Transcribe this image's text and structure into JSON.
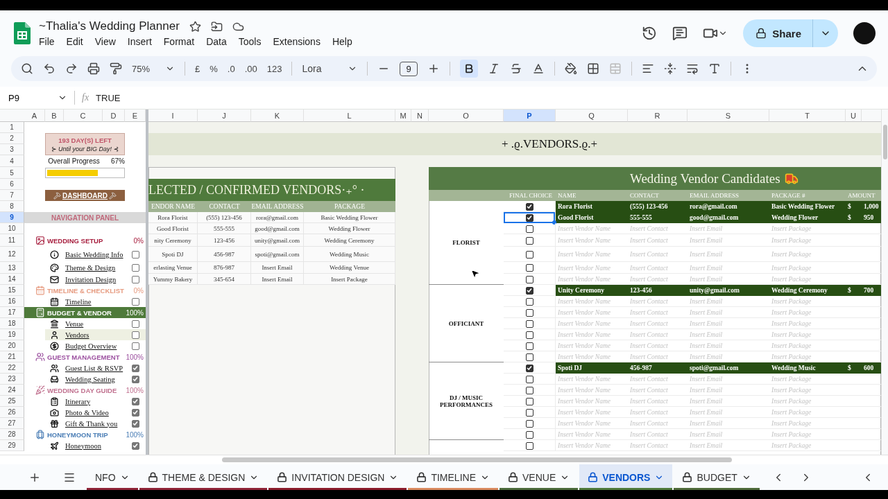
{
  "document": {
    "title": "~Thalia's Wedding Planner"
  },
  "menu": [
    "File",
    "Edit",
    "View",
    "Insert",
    "Format",
    "Data",
    "Tools",
    "Extensions",
    "Help"
  ],
  "share_button": {
    "label": "Share"
  },
  "toolbar": {
    "zoom": "75%",
    "currency": "£",
    "percent": "%",
    "decimals_less": ".0",
    "decimals_more": ".00",
    "number_format": "123",
    "font": "Lora",
    "font_size": "9",
    "bold_selected": true
  },
  "formula_bar": {
    "cell": "P9",
    "function_label": "fx",
    "value": "TRUE"
  },
  "columns": [
    {
      "label": "A",
      "selected": false
    },
    {
      "label": "B",
      "selected": false
    },
    {
      "label": "C",
      "selected": false
    },
    {
      "label": "D",
      "selected": false
    },
    {
      "label": "E",
      "selected": false
    },
    {
      "label": "I",
      "selected": false
    },
    {
      "label": "J",
      "selected": false
    },
    {
      "label": "K",
      "selected": false
    },
    {
      "label": "L",
      "selected": false
    },
    {
      "label": "M",
      "selected": false
    },
    {
      "label": "N",
      "selected": false
    },
    {
      "label": "O",
      "selected": false
    },
    {
      "label": "P",
      "selected": true
    },
    {
      "label": "Q",
      "selected": false
    },
    {
      "label": "R",
      "selected": false
    },
    {
      "label": "S",
      "selected": false
    },
    {
      "label": "T",
      "selected": false
    },
    {
      "label": "U",
      "selected": false
    }
  ],
  "rows": [
    {
      "label": "1",
      "selected": false
    },
    {
      "label": "2",
      "selected": false
    },
    {
      "label": "3",
      "selected": false
    },
    {
      "label": "4",
      "selected": false
    },
    {
      "label": "5",
      "selected": false
    },
    {
      "label": "6",
      "selected": false
    },
    {
      "label": "7",
      "selected": false
    },
    {
      "label": "8",
      "selected": false
    },
    {
      "label": "9",
      "selected": true
    },
    {
      "label": "10",
      "selected": false
    },
    {
      "label": "11",
      "selected": false
    },
    {
      "label": "12",
      "selected": false
    },
    {
      "label": "13",
      "selected": false
    },
    {
      "label": "14",
      "selected": false
    },
    {
      "label": "15",
      "selected": false
    },
    {
      "label": "16",
      "selected": false
    },
    {
      "label": "17",
      "selected": false
    },
    {
      "label": "18",
      "selected": false
    },
    {
      "label": "19",
      "selected": false
    },
    {
      "label": "20",
      "selected": false
    },
    {
      "label": "21",
      "selected": false
    },
    {
      "label": "22",
      "selected": false
    },
    {
      "label": "23",
      "selected": false
    },
    {
      "label": "24",
      "selected": false
    },
    {
      "label": "25",
      "selected": false
    },
    {
      "label": "26",
      "selected": false
    },
    {
      "label": "27",
      "selected": false
    },
    {
      "label": "28",
      "selected": false
    },
    {
      "label": "29",
      "selected": false
    }
  ],
  "countdown": {
    "days_left": "193 DAY(S) LEFT",
    "caption": "⊱ Until your BIG Day! ⊰"
  },
  "overall_progress": {
    "label": "Overall Progress",
    "reading": "67%",
    "level": 0.67
  },
  "dashboard_button": {
    "label": "DASHBOARD"
  },
  "navigation": {
    "title": "NAVIGATION PANEL",
    "sections": [
      {
        "title": "WEDDING SETUP",
        "percent": "0%",
        "color": "#a61c3c",
        "selected": false,
        "items": [
          {
            "label": "Basic Wedding Info",
            "checked": false,
            "selected": false
          },
          {
            "label": "Theme & Design",
            "checked": false,
            "selected": false
          },
          {
            "label": "Invitation Design",
            "checked": false,
            "selected": false
          }
        ]
      },
      {
        "title": "TIMELINE & CHECKLIST",
        "percent": "0%",
        "color": "#e69a7f",
        "selected": false,
        "items": [
          {
            "label": "Timeline",
            "checked": false,
            "selected": false
          }
        ]
      },
      {
        "title": "BUDGET & VENDOR",
        "percent": "100%",
        "color": "#4e7a3a",
        "selected": true,
        "items": [
          {
            "label": "Venue",
            "checked": false,
            "selected": false
          },
          {
            "label": "Vendors",
            "checked": false,
            "selected": true
          },
          {
            "label": "Budget Overview",
            "checked": false,
            "selected": false
          }
        ]
      },
      {
        "title": "GUEST MANAGEMENT",
        "percent": "100%",
        "color": "#9b4f9f",
        "selected": false,
        "items": [
          {
            "label": "Guest List & RSVP",
            "checked": true,
            "selected": false
          },
          {
            "label": "Wedding Seating",
            "checked": true,
            "selected": false
          }
        ]
      },
      {
        "title": "WEDDING DAY GUIDE",
        "percent": "100%",
        "color": "#c0718f",
        "selected": false,
        "items": [
          {
            "label": "Itinerary",
            "checked": true,
            "selected": false
          },
          {
            "label": "Photo & Video",
            "checked": true,
            "selected": false
          },
          {
            "label": "Gift & Thank you",
            "checked": true,
            "selected": false
          }
        ]
      },
      {
        "title": "HONEYMOON TRIP",
        "percent": "100%",
        "color": "#4a7db5",
        "selected": false,
        "items": [
          {
            "label": "Honeymoon",
            "checked": true,
            "selected": false
          }
        ]
      }
    ]
  },
  "page_title": "+ .ϱ.VENDORS.ϱ.+",
  "confirmed": {
    "title": "LECTED / CONFIRMED VENDORS·₊° ·",
    "columns": [
      "ENDOR NAME",
      "CONTACT",
      "EMAIL ADDRESS",
      "PACKAGE"
    ],
    "rows": [
      {
        "name": "Rora Florist",
        "contact": "(555) 123-456",
        "email": "rora@gmail.com",
        "package": "Basic Wedding Flower"
      },
      {
        "name": "Good Florist",
        "contact": "555-555",
        "email": "good@gmail.com",
        "package": "Wedding Flower"
      },
      {
        "name": "nity Ceremony",
        "contact": "123-456",
        "email": "unity@gmail.com",
        "package": "Wedding Ceremony"
      },
      {
        "name": "Spoti DJ",
        "contact": "456-987",
        "email": "spoti@gmail.com",
        "package": "Wedding Music"
      },
      {
        "name": "erlasting Venue",
        "contact": "876-987",
        "email": "Insert Email",
        "package": "Wedding Venue"
      },
      {
        "name": "Yummy Bakery",
        "contact": "345-654",
        "email": "Insert Email",
        "package": "Insert Package"
      }
    ]
  },
  "candidates": {
    "title": "Wedding Vendor Candidates",
    "columns": [
      "FINAL CHOICE",
      "NAME",
      "CONTACT",
      "EMAIL ADDRESS",
      "PACKAGE #",
      "AMOUNT"
    ],
    "groups": [
      {
        "category": "FLORIST",
        "rows": [
          {
            "checked": true,
            "selected": false,
            "name": "Rora Florist",
            "contact": "(555) 123-456",
            "email": "rora@gmail.com",
            "package": "Basic Wedding Flower",
            "currency": "$",
            "amount": "1,000"
          },
          {
            "checked": true,
            "selected": true,
            "name": "Good Florist",
            "contact": "555-555",
            "email": "good@gmail.com",
            "package": "Wedding Flower",
            "currency": "$",
            "amount": "950"
          },
          {
            "checked": false,
            "selected": false,
            "name": "Insert Vendor Name",
            "contact": "Insert Contact",
            "email": "Insert Email",
            "package": "Insert Package"
          },
          {
            "checked": false,
            "selected": false,
            "name": "Insert Vendor Name",
            "contact": "Insert Contact",
            "email": "Insert Email",
            "package": "Insert Package"
          },
          {
            "checked": false,
            "selected": false,
            "name": "Insert Vendor Name",
            "contact": "Insert Contact",
            "email": "Insert Email",
            "package": "Insert Package"
          },
          {
            "checked": false,
            "selected": false,
            "name": "Insert Vendor Name",
            "contact": "Insert Contact",
            "email": "Insert Email",
            "package": "Insert Package"
          },
          {
            "checked": false,
            "selected": false,
            "name": "Insert Vendor Name",
            "contact": "Insert Contact",
            "email": "Insert Email",
            "package": "Insert Package"
          }
        ]
      },
      {
        "category": "OFFICIANT",
        "rows": [
          {
            "checked": true,
            "selected": false,
            "name": "Unity Ceremony",
            "contact": "123-456",
            "email": "unity@gmail.com",
            "package": "Wedding Ceremony",
            "currency": "$",
            "amount": "700"
          },
          {
            "checked": false,
            "selected": false,
            "name": "Insert Vendor Name",
            "contact": "Insert Contact",
            "email": "Insert Email",
            "package": "Insert Package"
          },
          {
            "checked": false,
            "selected": false,
            "name": "Insert Vendor Name",
            "contact": "Insert Contact",
            "email": "Insert Email",
            "package": "Insert Package"
          },
          {
            "checked": false,
            "selected": false,
            "name": "Insert Vendor Name",
            "contact": "Insert Contact",
            "email": "Insert Email",
            "package": "Insert Package"
          },
          {
            "checked": false,
            "selected": false,
            "name": "Insert Vendor Name",
            "contact": "Insert Contact",
            "email": "Insert Email",
            "package": "Insert Package"
          },
          {
            "checked": false,
            "selected": false,
            "name": "Insert Vendor Name",
            "contact": "Insert Contact",
            "email": "Insert Email",
            "package": "Insert Package"
          },
          {
            "checked": false,
            "selected": false,
            "name": "Insert Vendor Name",
            "contact": "Insert Contact",
            "email": "Insert Email",
            "package": "Insert Package"
          }
        ]
      },
      {
        "category": "DJ / MUSIC PERFORMANCES",
        "rows": [
          {
            "checked": true,
            "selected": false,
            "name": "Spoti DJ",
            "contact": "456-987",
            "email": "spoti@gmail.com",
            "package": "Wedding Music",
            "currency": "$",
            "amount": "600"
          },
          {
            "checked": false,
            "selected": false,
            "name": "Insert Vendor Name",
            "contact": "Insert Contact",
            "email": "Insert Email",
            "package": "Insert Package"
          },
          {
            "checked": false,
            "selected": false,
            "name": "Insert Vendor Name",
            "contact": "Insert Contact",
            "email": "Insert Email",
            "package": "Insert Package"
          },
          {
            "checked": false,
            "selected": false,
            "name": "Insert Vendor Name",
            "contact": "Insert Contact",
            "email": "Insert Email",
            "package": "Insert Package"
          },
          {
            "checked": false,
            "selected": false,
            "name": "Insert Vendor Name",
            "contact": "Insert Contact",
            "email": "Insert Email",
            "package": "Insert Package"
          },
          {
            "checked": false,
            "selected": false,
            "name": "Insert Vendor Name",
            "contact": "Insert Contact",
            "email": "Insert Email",
            "package": "Insert Package"
          },
          {
            "checked": false,
            "selected": false,
            "name": "Insert Vendor Name",
            "contact": "Insert Contact",
            "email": "Insert Email",
            "package": "Insert Package"
          }
        ]
      },
      {
        "rows": [
          {
            "checked": false,
            "selected": false,
            "name": "Insert Vendor Name",
            "contact": "Insert Contact",
            "email": "Insert Email",
            "package": "Insert Package"
          }
        ]
      }
    ]
  },
  "sheet_tabs": [
    {
      "label": "NFO",
      "locked": false,
      "selected": false,
      "color": "#8e2437"
    },
    {
      "label": "THEME & DESIGN",
      "locked": true,
      "selected": false,
      "color": "#8e2437"
    },
    {
      "label": "INVITATION DESIGN",
      "locked": true,
      "selected": false,
      "color": "#8a1c2c"
    },
    {
      "label": "TIMELINE",
      "locked": true,
      "selected": false,
      "color": "#d98a5f"
    },
    {
      "label": "VENUE",
      "locked": true,
      "selected": false,
      "color": "#4c6b3c"
    },
    {
      "label": "VENDORS",
      "locked": true,
      "selected": true,
      "color": "#4f7a3a"
    },
    {
      "label": "BUDGET",
      "locked": true,
      "selected": false,
      "color": "#4f6b3a"
    }
  ]
}
